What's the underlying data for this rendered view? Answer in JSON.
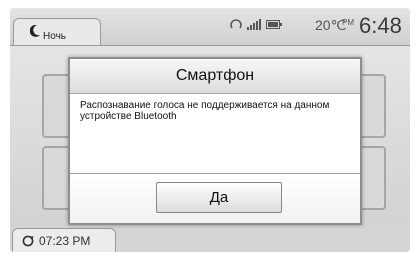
{
  "header": {
    "mode_label": "Ночь",
    "temperature": "20℃",
    "ampm": "PM",
    "clock": "6:48",
    "icons": [
      "moon-icon",
      "gps-icon",
      "signal-icon",
      "battery-icon"
    ]
  },
  "dialog": {
    "title": "Смартфон",
    "message": "Распознавание голоса не поддерживается на данном устройстве Bluetooth",
    "ok_label": "Да"
  },
  "footer": {
    "time": "07:23 PM",
    "icon": "clock-icon"
  }
}
